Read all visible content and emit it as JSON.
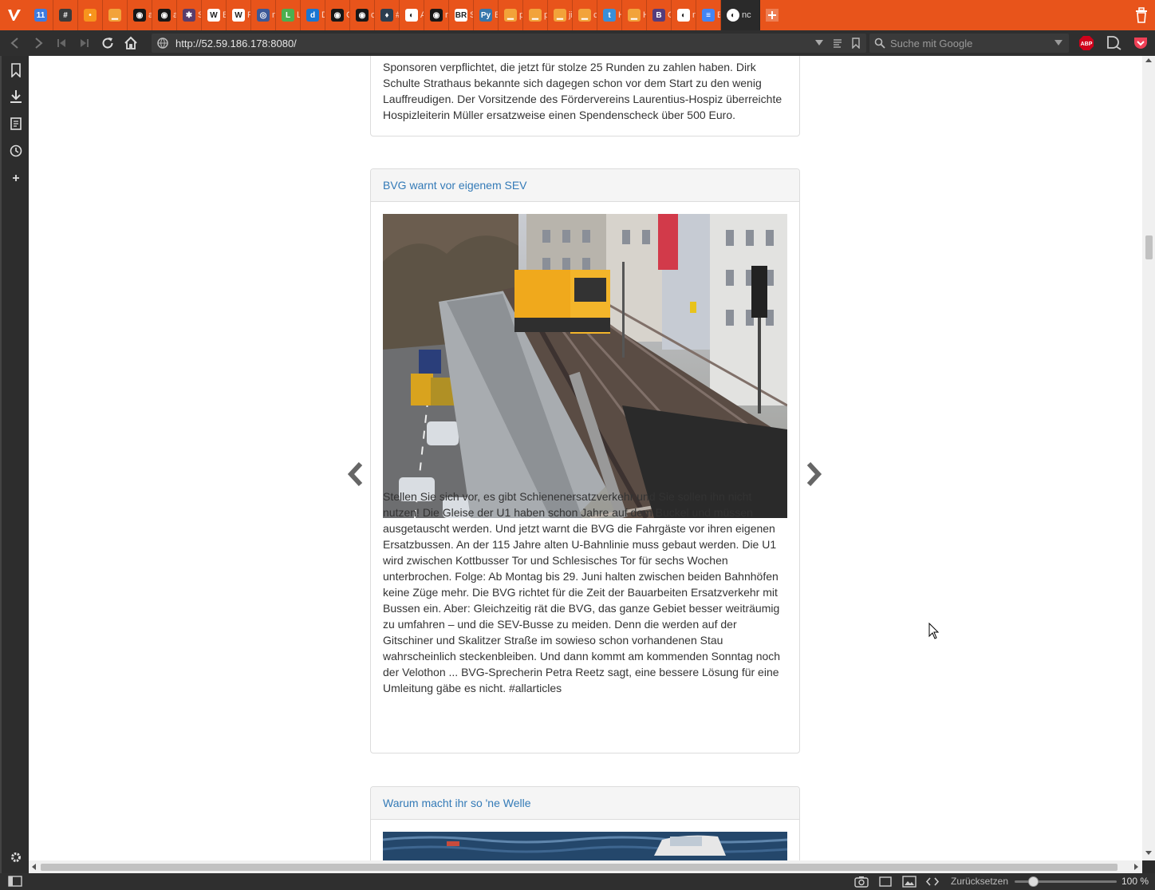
{
  "browser": {
    "active_tab_label": "nc",
    "url": "http://52.59.186.178:8080/",
    "search_placeholder": "Suche mit Google",
    "accent_color": "#e8541b",
    "tabs": [
      {
        "icon": "calendar-icon",
        "label": "",
        "color": "#3d7be0",
        "glyph": "11"
      },
      {
        "icon": "hash-icon",
        "label": "",
        "color": "#3a3a3a",
        "glyph": "#"
      },
      {
        "icon": "orange-dot-icon",
        "label": "",
        "color": "#f7941d",
        "glyph": "•"
      },
      {
        "icon": "chart-bars-icon",
        "label": "",
        "color": "#f2a33a",
        "glyph": "▁"
      },
      {
        "icon": "github-icon",
        "label": "av",
        "color": "#181717",
        "glyph": "◉"
      },
      {
        "icon": "github-icon",
        "label": "av",
        "color": "#181717",
        "glyph": "◉"
      },
      {
        "icon": "slack-icon",
        "label": "Si",
        "color": "#5a3d6b",
        "glyph": "✱"
      },
      {
        "icon": "wikipedia-icon",
        "label": "Bi",
        "color": "#ffffff",
        "glyph": "W"
      },
      {
        "icon": "wikipedia-icon",
        "label": "Ri",
        "color": "#ffffff",
        "glyph": "W"
      },
      {
        "icon": "owl-icon",
        "label": "mi",
        "color": "#3b5998",
        "glyph": "◎"
      },
      {
        "icon": "leaf-icon",
        "label": "Lo",
        "color": "#4caf50",
        "glyph": "L"
      },
      {
        "icon": "d-icon",
        "label": "Di",
        "color": "#1976d2",
        "glyph": "d"
      },
      {
        "icon": "github-icon",
        "label": "G",
        "color": "#181717",
        "glyph": "◉"
      },
      {
        "icon": "github-icon",
        "label": "op",
        "color": "#181717",
        "glyph": "◉"
      },
      {
        "icon": "pin-icon",
        "label": "#1",
        "color": "#2c3e50",
        "glyph": "♦"
      },
      {
        "icon": "globe-icon",
        "label": "Ai",
        "color": "#ffffff",
        "glyph": "◐"
      },
      {
        "icon": "github-icon",
        "label": "nc",
        "color": "#181717",
        "glyph": "◉"
      },
      {
        "icon": "br-icon",
        "label": "Se",
        "color": "#ffffff",
        "glyph": "BR"
      },
      {
        "icon": "python-icon",
        "label": "Ba",
        "color": "#3776ab",
        "glyph": "Py"
      },
      {
        "icon": "chart-bars-icon",
        "label": "py",
        "color": "#f2a33a",
        "glyph": "▁"
      },
      {
        "icon": "chart-bars-icon",
        "label": "py",
        "color": "#f2a33a",
        "glyph": "▁"
      },
      {
        "icon": "chart-bars-icon",
        "label": "jin",
        "color": "#f2a33a",
        "glyph": "▁"
      },
      {
        "icon": "chart-bars-icon",
        "label": "cs",
        "color": "#f2a33a",
        "glyph": "▁"
      },
      {
        "icon": "t-icon",
        "label": "H",
        "color": "#3a8fd8",
        "glyph": "t"
      },
      {
        "icon": "chart-bars-icon",
        "label": "Ho",
        "color": "#f2a33a",
        "glyph": "▁"
      },
      {
        "icon": "bootstrap-icon",
        "label": "Co",
        "color": "#563d7c",
        "glyph": "B"
      },
      {
        "icon": "globe-icon",
        "label": "nc",
        "color": "#ffffff",
        "glyph": "◐"
      },
      {
        "icon": "docs-icon",
        "label": "Bi",
        "color": "#4285f4",
        "glyph": "≡"
      }
    ]
  },
  "content": {
    "top_card_text": "Sponsoren verpflichtet, die jetzt für stolze 25 Runden zu zahlen haben. Dirk Schulte Strathaus bekannte sich dagegen schon vor dem Start zu den wenig Lauffreudigen. Der Vorsitzende des Fördervereins Laurentius-Hospiz überreichte Hospizleiterin Müller ersatzweise einen Spendenscheck über 500 Euro.",
    "article1": {
      "title": "BVG warnt vor eigenem SEV",
      "text": "Stellen Sie sich vor, es gibt Schienenersatzverkehr und Sie sollen ihn nicht nutzen! Die Gleise der U1 haben schon Jahre auf dem Buckel und müssen ausgetauscht werden. Und jetzt warnt die BVG die Fahrgäste vor ihren eigenen Ersatzbussen. An der 115 Jahre alten U-Bahnlinie muss gebaut werden. Die U1 wird zwischen Kottbusser Tor und Schlesisches Tor für sechs Wochen unterbrochen. Folge: Ab Montag bis 29. Juni halten zwischen beiden Bahnhöfen keine Züge mehr. Die BVG richtet für die Zeit der Bauarbeiten Ersatzverkehr mit Bussen ein. Aber: Gleichzeitig rät die BVG, das ganze Gebiet besser weiträumig zu umfahren – und die SEV-Busse zu meiden. Denn die werden auf der Gitschiner und Skalitzer Straße im sowieso schon vorhandenen Stau wahrscheinlich steckenbleiben. Und dann kommt am kommenden Sonntag noch der Velothon ... BVG-Sprecherin Petra Reetz sagt, eine bessere Lösung für eine Umleitung gäbe es nicht. #allarticles"
    },
    "article2": {
      "title": "Warum macht ihr so 'ne Welle"
    }
  },
  "statusbar": {
    "reset_label": "Zurücksetzen",
    "zoom": "100 %"
  }
}
